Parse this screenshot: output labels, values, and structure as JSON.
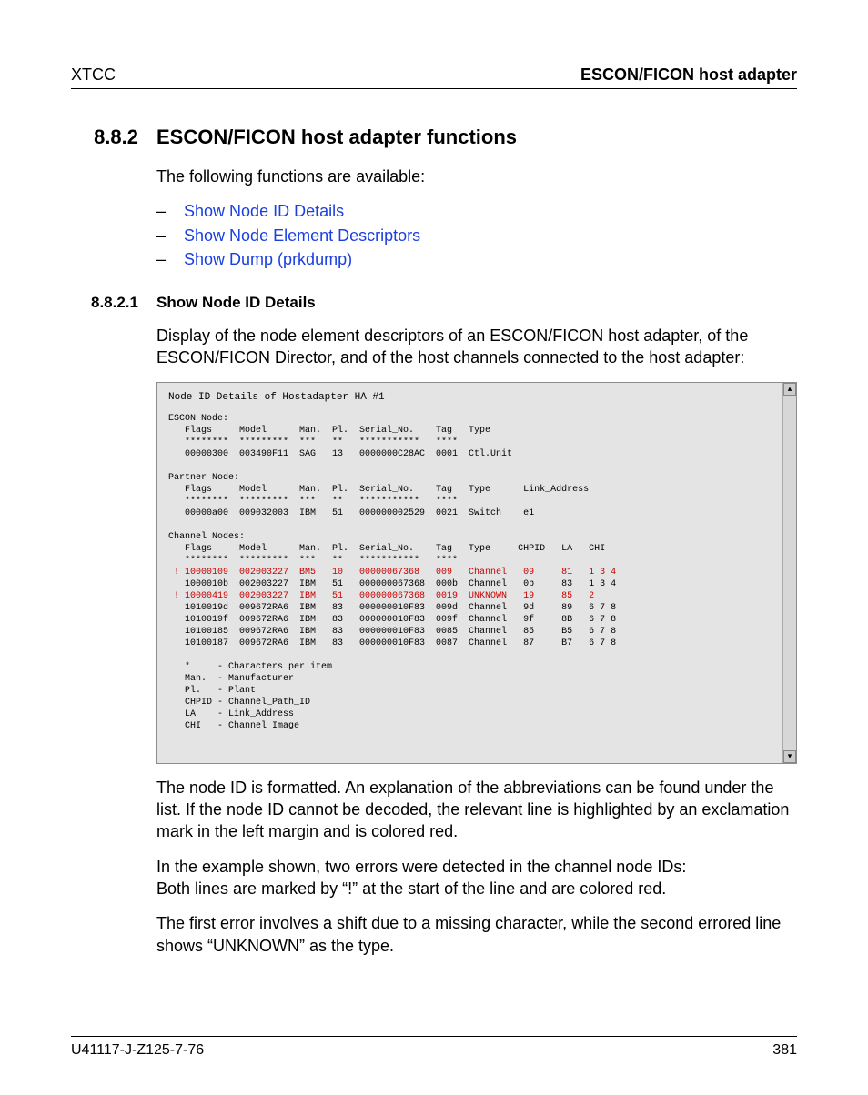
{
  "header": {
    "left": "XTCC",
    "right": "ESCON/FICON host adapter"
  },
  "section": {
    "number": "8.8.2",
    "title": "ESCON/FICON host adapter functions",
    "intro": "The following functions are available:",
    "bullets": [
      "Show Node ID Details",
      "Show Node Element Descriptors",
      "Show Dump (prkdump)"
    ]
  },
  "subsection": {
    "number": "8.8.2.1",
    "title": "Show Node ID Details",
    "p1": "Display of the node element descriptors of an ESCON/FICON host adapter, of the ESCON/FICON Director, and of the host channels connected to the host adapter:"
  },
  "screenshot": {
    "title": "Node ID Details of Hostadapter HA #1",
    "groups": [
      {
        "name": "ESCON Node:",
        "header": "   Flags     Model      Man.  Pl.  Serial_No.    Tag   Type",
        "asterisk": "   ********  *********  ***   **   ***********   ****",
        "lines": [
          {
            "t": "   00000300  003490F11  SAG   13   0000000C28AC  0001  Ctl.Unit",
            "red": false
          }
        ]
      },
      {
        "name": "Partner Node:",
        "header": "   Flags     Model      Man.  Pl.  Serial_No.    Tag   Type      Link_Address",
        "asterisk": "   ********  *********  ***   **   ***********   ****",
        "lines": [
          {
            "t": "   00000a00  009032003  IBM   51   000000002529  0021  Switch    e1",
            "red": false
          }
        ]
      },
      {
        "name": "Channel Nodes:",
        "header": "   Flags     Model      Man.  Pl.  Serial_No.    Tag   Type     CHPID   LA   CHI",
        "asterisk": "   ********  *********  ***   **   ***********   ****",
        "lines": [
          {
            "t": " ! 10000109  002003227  BM5   10   00000067368   009   Channel   09     81   1 3 4",
            "red": true
          },
          {
            "t": "   1000010b  002003227  IBM   51   000000067368  000b  Channel   0b     83   1 3 4",
            "red": false
          },
          {
            "t": " ! 10000419  002003227  IBM   51   000000067368  0019  UNKNOWN   19     85   2",
            "red": true
          },
          {
            "t": "   1010019d  009672RA6  IBM   83   000000010F83  009d  Channel   9d     89   6 7 8",
            "red": false
          },
          {
            "t": "   1010019f  009672RA6  IBM   83   000000010F83  009f  Channel   9f     8B   6 7 8",
            "red": false
          },
          {
            "t": "   10100185  009672RA6  IBM   83   000000010F83  0085  Channel   85     B5   6 7 8",
            "red": false
          },
          {
            "t": "   10100187  009672RA6  IBM   83   000000010F83  0087  Channel   87     B7   6 7 8",
            "red": false
          }
        ]
      }
    ],
    "legend": [
      "   *     - Characters per item",
      "   Man.  - Manufacturer",
      "   Pl.   - Plant",
      "   CHPID - Channel_Path_ID",
      "   LA    - Link_Address",
      "   CHI   - Channel_Image"
    ]
  },
  "afterText": {
    "p1": "The node ID is formatted. An explanation of the abbreviations can be found under the list. If the node ID cannot be decoded, the relevant line is highlighted by an exclamation mark in the left margin and is colored red.",
    "p2a": "In the example shown, two errors were detected in the channel node IDs:",
    "p2b": "Both lines are marked by “!” at the start of the line and are colored red.",
    "p3": "The first error involves a shift due to a missing character, while the second errored line shows “UNKNOWN” as the type."
  },
  "footer": {
    "left": "U41117-J-Z125-7-76",
    "right": "381"
  }
}
